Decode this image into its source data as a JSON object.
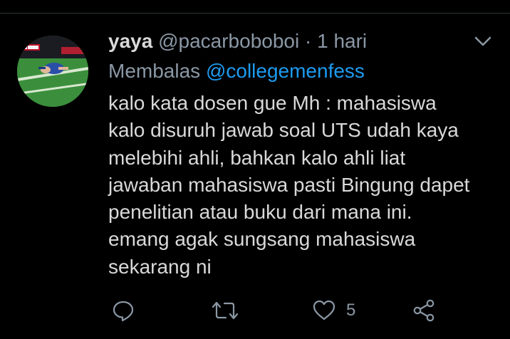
{
  "tweet": {
    "author_name": "yaya",
    "author_handle": "@pacarboboboi",
    "separator": "·",
    "time": "1 hari",
    "reply_prefix": "Membalas",
    "reply_to": "@collegemenfess",
    "text_lines": [
      "kalo kata dosen gue Mh :  mahasiswa",
      "kalo disuruh jawab soal UTS udah kaya",
      "melebihi ahli, bahkan kalo ahli liat",
      "jawaban mahasiswa pasti Bingung dapet",
      "penelitian atau buku dari mana ini.",
      "emang agak sungsang mahasiswa",
      "sekarang ni"
    ]
  },
  "actions": {
    "reply_icon": "reply-icon",
    "retweet_icon": "retweet-icon",
    "like_icon": "heart-icon",
    "like_count": "5",
    "share_icon": "share-icon"
  },
  "colors": {
    "background": "#000000",
    "text": "#d9d9d9",
    "secondary": "#8b98a5",
    "link": "#1d9bf0"
  }
}
